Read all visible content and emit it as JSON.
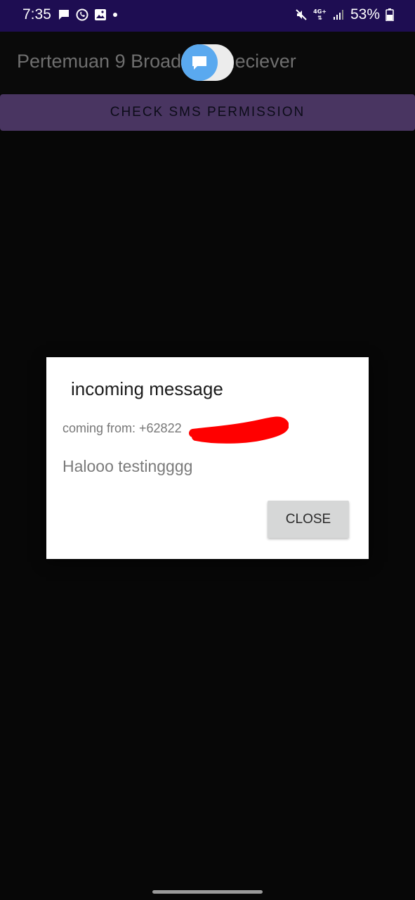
{
  "status_bar": {
    "time": "7:35",
    "battery_percent": "53%",
    "network_tag": "4G+",
    "icons_left": [
      "message-icon",
      "whatsapp-icon",
      "gallery-icon",
      "dot-icon"
    ],
    "icons_right": [
      "mute-icon",
      "network-4g-icon",
      "signal-icon",
      "battery-icon"
    ]
  },
  "app_bar": {
    "title": "Pertemuan 9 Broadcast Reciever"
  },
  "main": {
    "permission_button_label": "CHECK SMS PERMISSION"
  },
  "dialog": {
    "title": "incoming message",
    "from_label": "coming from: +62822",
    "message": "Halooo testingggg",
    "close_label": "CLOSE"
  },
  "colors": {
    "status_bar_bg": "#1e0d52",
    "button_bg": "#493561",
    "bubble_blue": "#5aa9ef",
    "redaction_red": "#ff0000"
  }
}
